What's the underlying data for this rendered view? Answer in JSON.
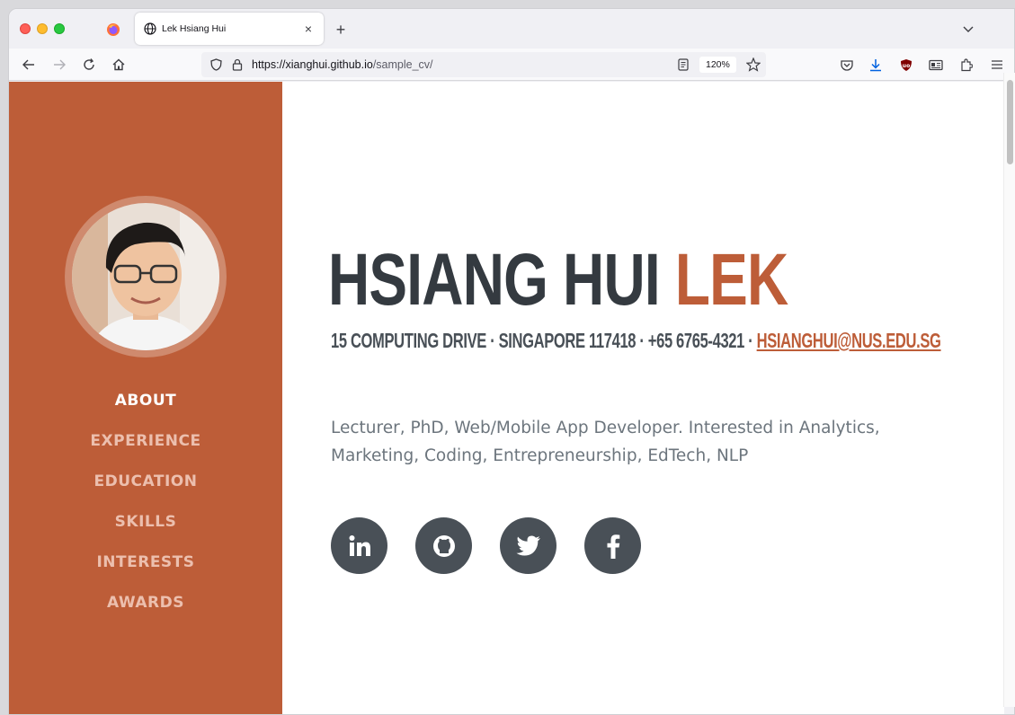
{
  "browser": {
    "tab_title": "Lek Hsiang Hui",
    "tab_close": "×",
    "new_tab": "+",
    "url_host": "https://xianghui.github.io",
    "url_path": "/sample_cv/",
    "zoom": "120%"
  },
  "sidebar": {
    "nav": [
      {
        "label": "ABOUT",
        "active": true
      },
      {
        "label": "EXPERIENCE"
      },
      {
        "label": "EDUCATION"
      },
      {
        "label": "SKILLS"
      },
      {
        "label": "INTERESTS"
      },
      {
        "label": "AWARDS"
      }
    ],
    "accent": "#bd5d38"
  },
  "profile": {
    "first_name": "HSIANG HUI",
    "last_name": "LEK",
    "contact": "15 COMPUTING DRIVE · SINGAPORE 117418 · +65 6765-4321 · ",
    "email": "HSIANGHUI@NUS.EDU.SG",
    "bio": "Lecturer, PhD, Web/Mobile App Developer. Interested in Analytics, Marketing, Coding, Entrepreneurship, EdTech, NLP"
  },
  "social": [
    "linkedin-icon",
    "github-icon",
    "twitter-icon",
    "facebook-icon"
  ],
  "colors": {
    "accent": "#bd5d38",
    "dark": "#343a40",
    "icon_bg": "#495057"
  }
}
